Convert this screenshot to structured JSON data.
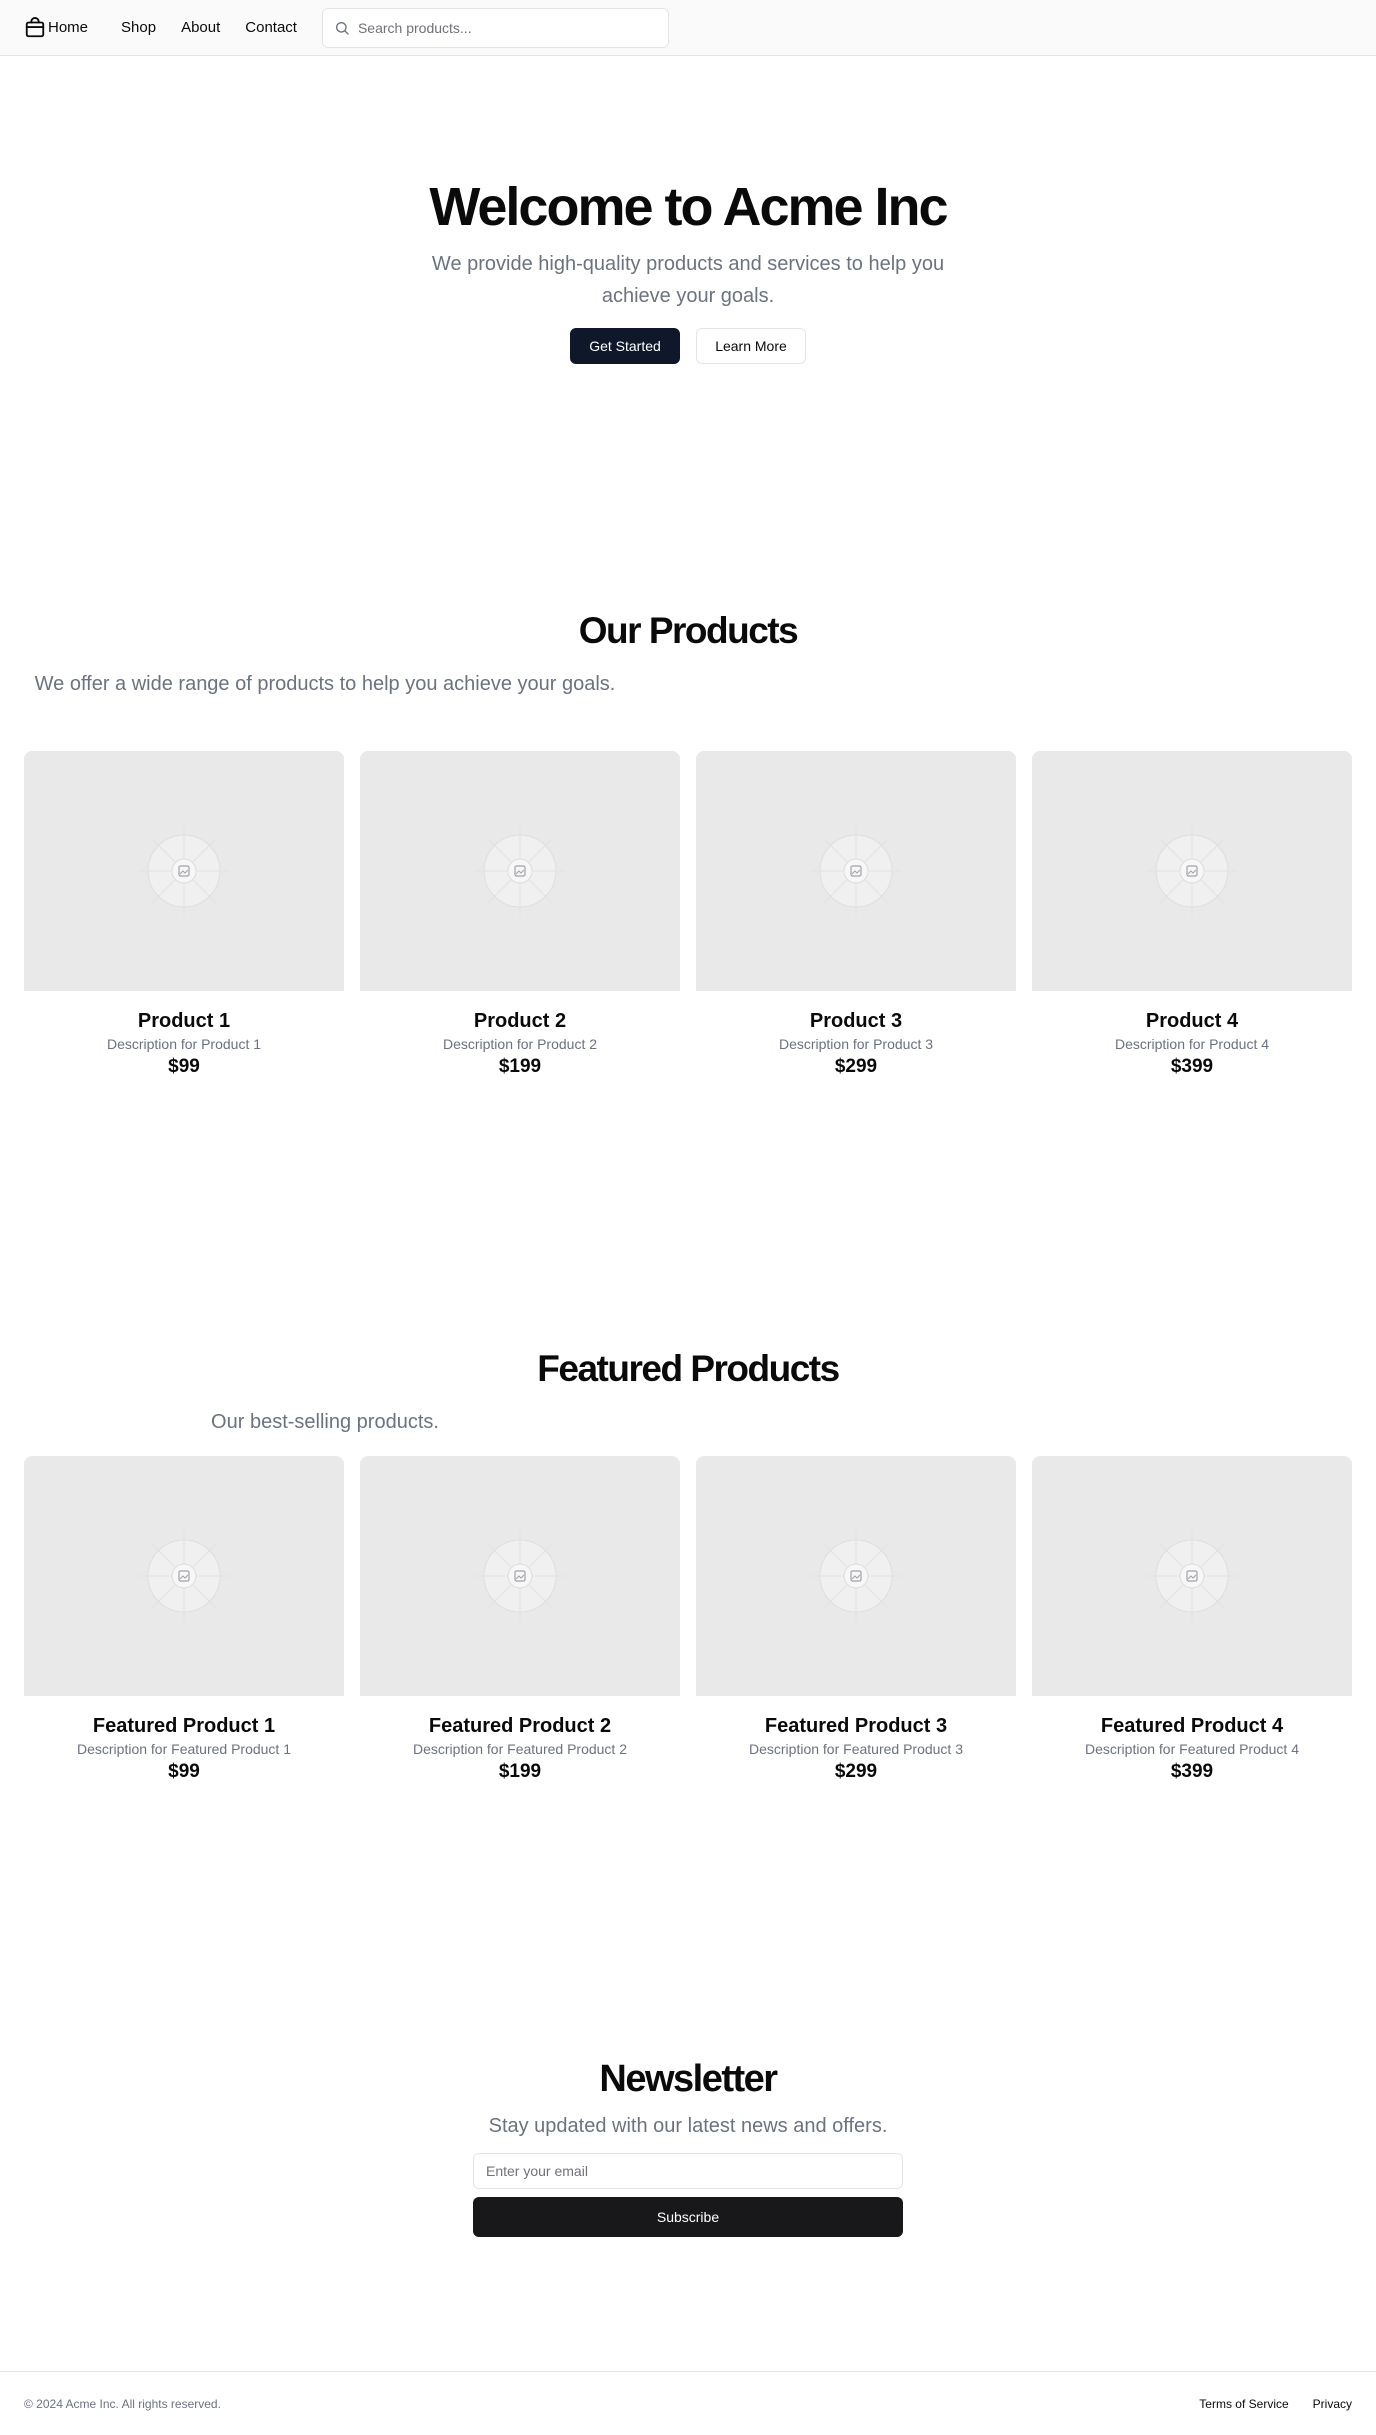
{
  "nav": {
    "items": [
      {
        "label": "Home"
      },
      {
        "label": "Shop"
      },
      {
        "label": "About"
      },
      {
        "label": "Contact"
      }
    ],
    "search_placeholder": "Search products..."
  },
  "hero": {
    "title": "Welcome to Acme Inc",
    "subtitle": "We provide high-quality products and services to help you achieve your goals.",
    "primary_button": "Get Started",
    "secondary_button": "Learn More"
  },
  "products": {
    "title": "Our Products",
    "subtitle": "We offer a wide range of products to help you achieve your goals.",
    "items": [
      {
        "name": "Product 1",
        "description": "Description for Product 1",
        "price": "$99"
      },
      {
        "name": "Product 2",
        "description": "Description for Product 2",
        "price": "$199"
      },
      {
        "name": "Product 3",
        "description": "Description for Product 3",
        "price": "$299"
      },
      {
        "name": "Product 4",
        "description": "Description for Product 4",
        "price": "$399"
      }
    ]
  },
  "featured": {
    "title": "Featured Products",
    "subtitle": "Our best-selling products.",
    "items": [
      {
        "name": "Featured Product 1",
        "description": "Description for Featured Product 1",
        "price": "$99"
      },
      {
        "name": "Featured Product 2",
        "description": "Description for Featured Product 2",
        "price": "$199"
      },
      {
        "name": "Featured Product 3",
        "description": "Description for Featured Product 3",
        "price": "$299"
      },
      {
        "name": "Featured Product 4",
        "description": "Description for Featured Product 4",
        "price": "$399"
      }
    ]
  },
  "newsletter": {
    "title": "Newsletter",
    "subtitle": "Stay updated with our latest news and offers.",
    "email_placeholder": "Enter your email",
    "button": "Subscribe"
  },
  "footer": {
    "copyright": "© 2024 Acme Inc. All rights reserved.",
    "links": [
      {
        "label": "Terms of Service"
      },
      {
        "label": "Privacy"
      }
    ]
  },
  "colors": {
    "primary_button": "#0f172a",
    "subscribe_button": "#18181b",
    "muted_text": "#6b7280",
    "image_placeholder": "#e9e9e9"
  },
  "icons": {
    "logo": "shopping-bag-icon",
    "search": "search-icon",
    "image_placeholder": "image-placeholder-icon"
  }
}
